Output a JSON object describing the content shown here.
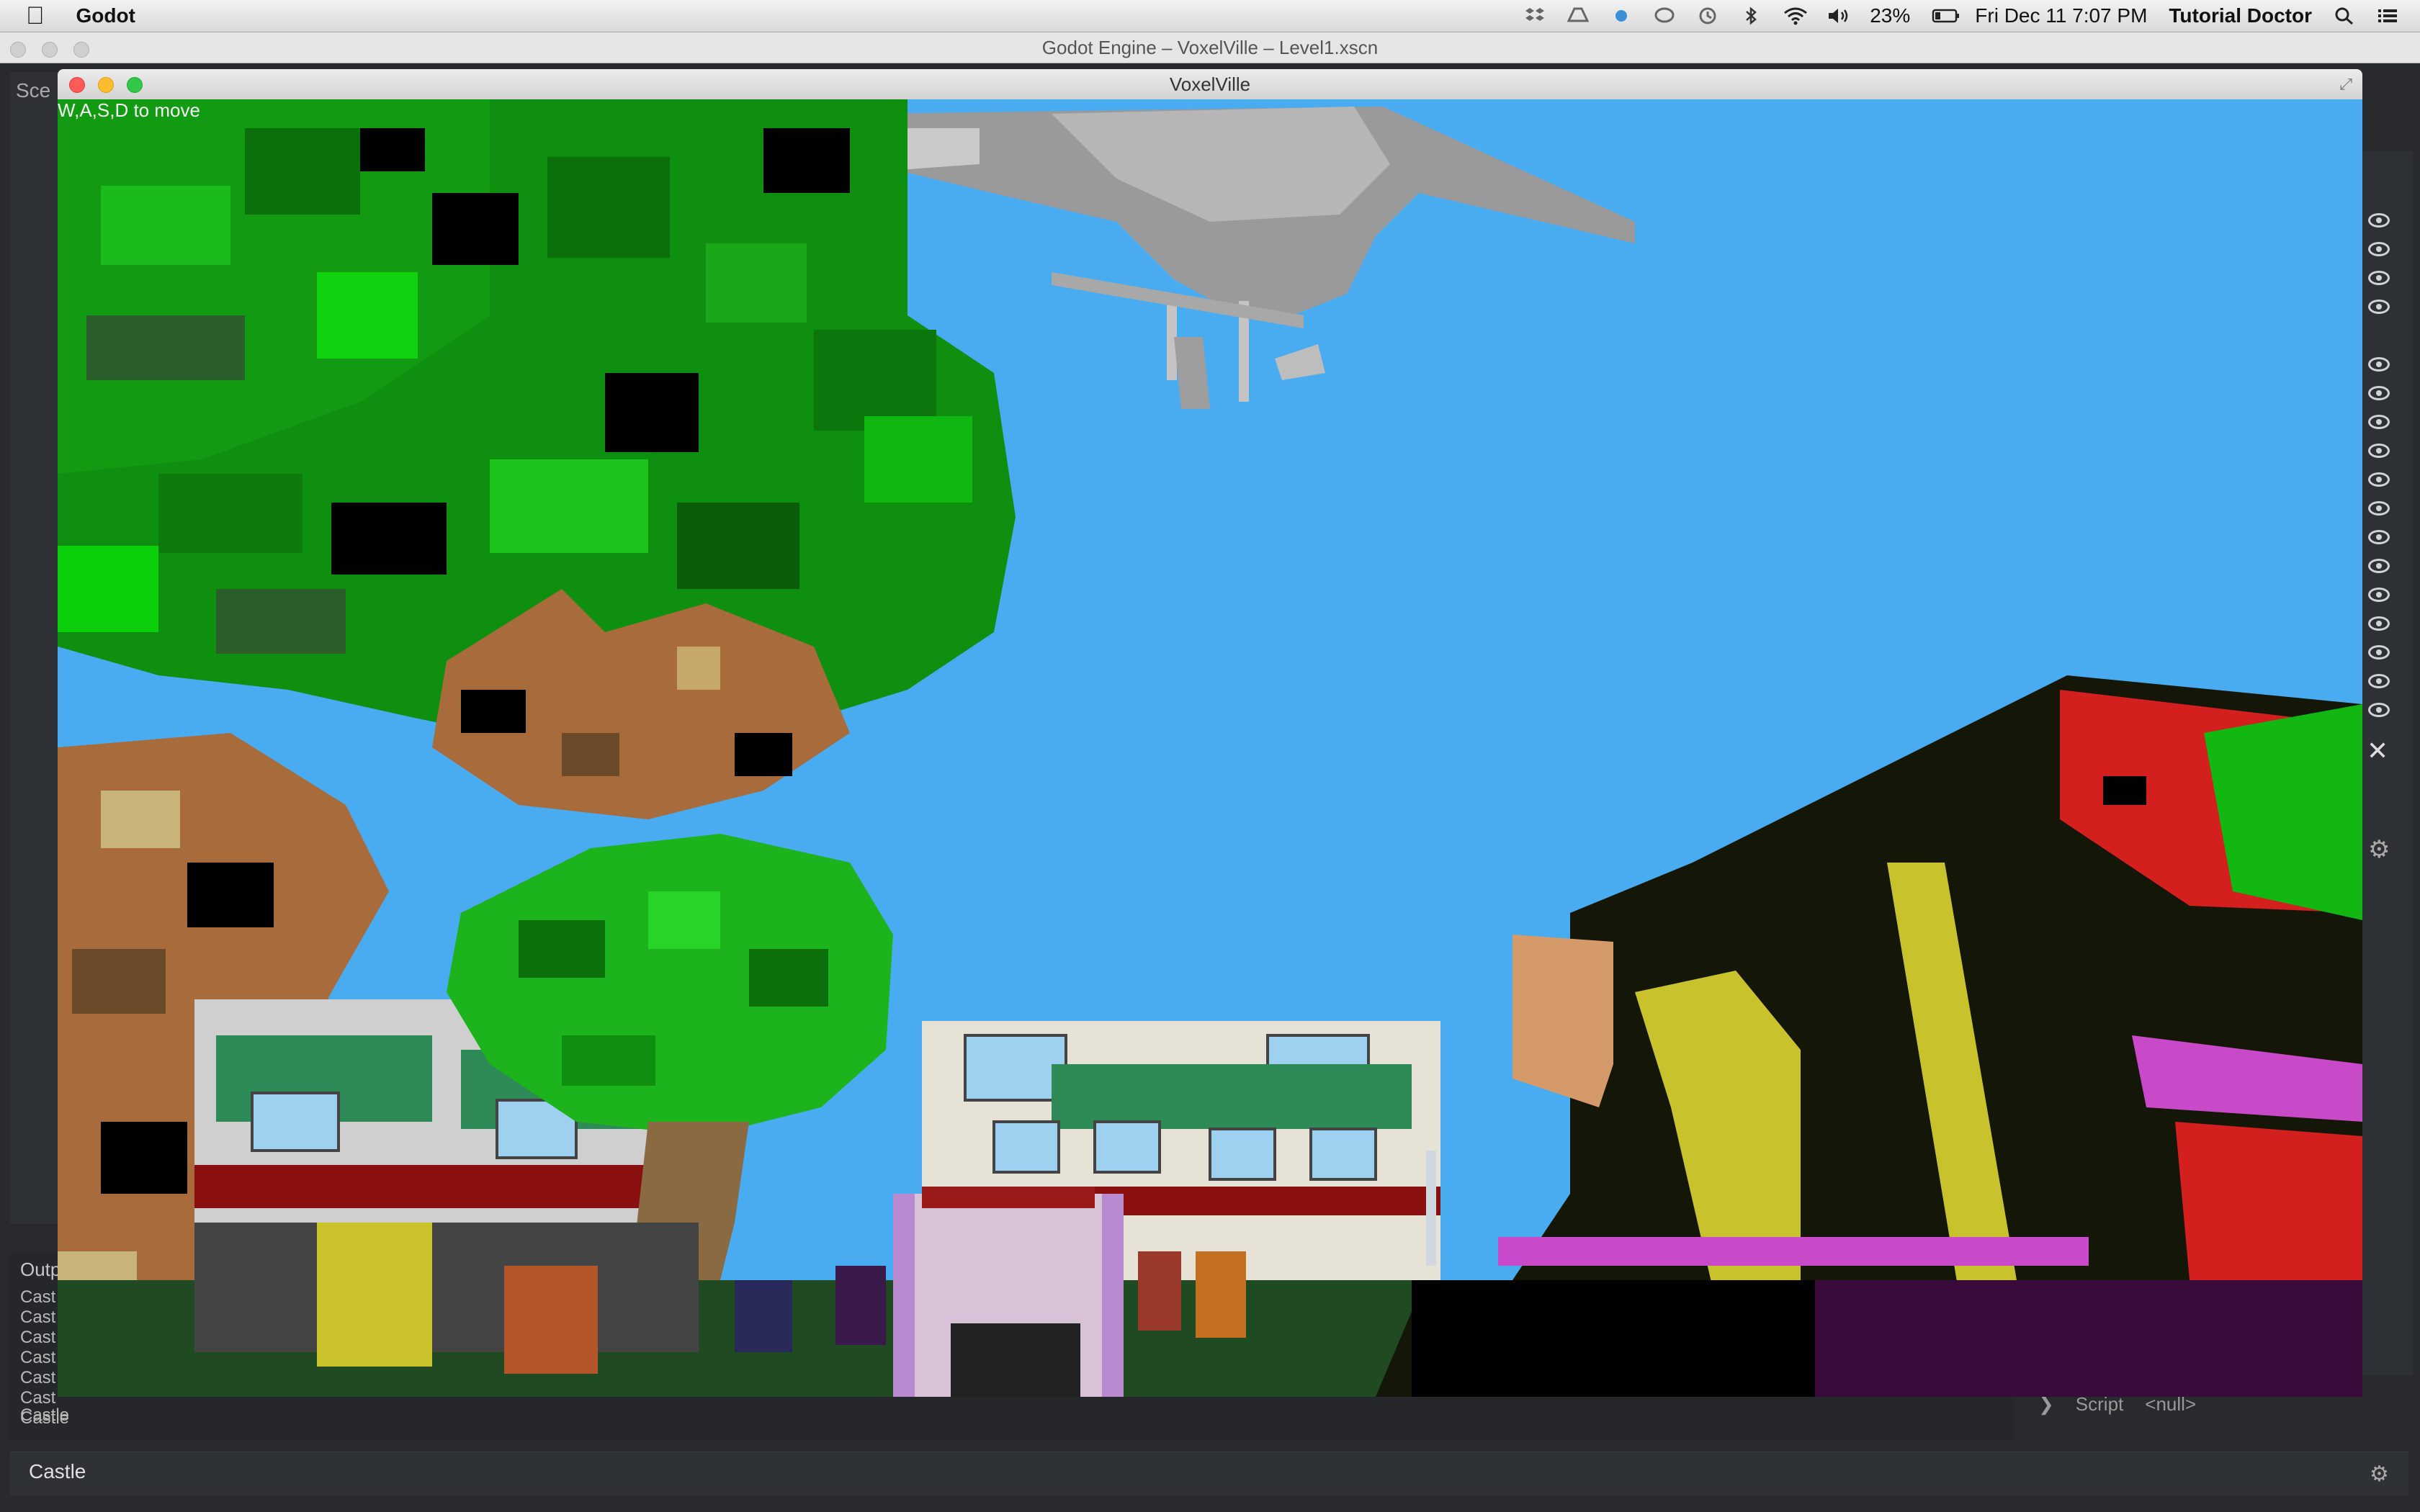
{
  "menubar": {
    "app_name": "Godot",
    "battery": "23%",
    "datetime": "Fri Dec 11  7:07 PM",
    "user": "Tutorial Doctor"
  },
  "editor": {
    "window_title": "Godot Engine – VoxelVille – Level1.xscn",
    "left_tab": "Sce",
    "output_label": "Outp",
    "output_lines": [
      "Cast",
      "Cast",
      "Cast",
      "Cast",
      "Cast",
      "Cast",
      "Castle",
      "Castle"
    ],
    "status_text": "Castle",
    "script_label": "Script",
    "script_value": "<null>"
  },
  "game": {
    "window_title": "VoxelVille",
    "hint": "W,A,S,D to move"
  }
}
